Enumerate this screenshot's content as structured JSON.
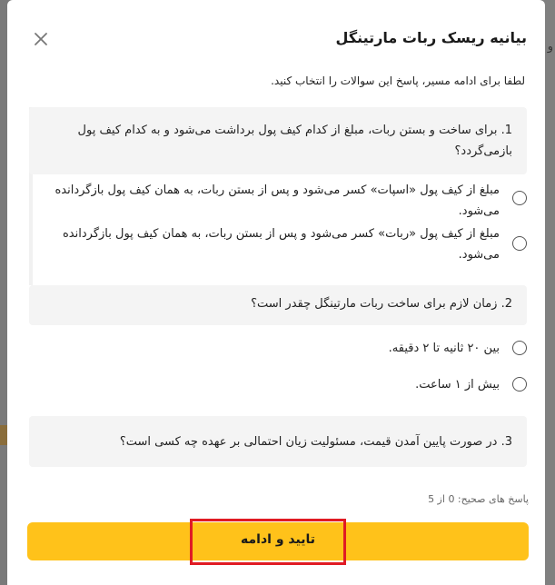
{
  "background": {
    "glyph": "و"
  },
  "modal": {
    "title": "بیانیه ریسک ربات مارتینگل",
    "close_icon": "close-icon",
    "intro": "لطفا برای ادامه مسیر، پاسخ این سوالات را انتخاب کنید."
  },
  "questions": [
    {
      "text": "1. برای ساخت و بستن ربات، مبلغ از کدام کیف پول برداشت می‌شود و به کدام کیف پول بازمی‌گردد؟",
      "options": [
        "مبلغ از کیف پول «اسپات» کسر می‌شود و پس از بستن ربات، به همان کیف پول بازگردانده می‌شود.",
        "مبلغ از کیف پول «ربات» کسر می‌شود و پس از بستن ربات، به همان کیف پول بازگردانده می‌شود."
      ]
    },
    {
      "text": "2. زمان لازم برای ساخت ربات مارتینگل چقدر است؟",
      "options": [
        "بین ۲۰ ثانیه تا ۲ دقیقه.",
        "بیش از ۱ ساعت."
      ]
    },
    {
      "text": "3. در صورت پایین آمدن قیمت، مسئولیت زیان احتمالی بر عهده چه کسی است؟",
      "options": []
    }
  ],
  "score_text": "پاسخ های صحیح: 0 از 5",
  "confirm_button": {
    "label": "تایید و ادامه",
    "color": "#ffc21a",
    "highlight_color": "#e01b24"
  }
}
